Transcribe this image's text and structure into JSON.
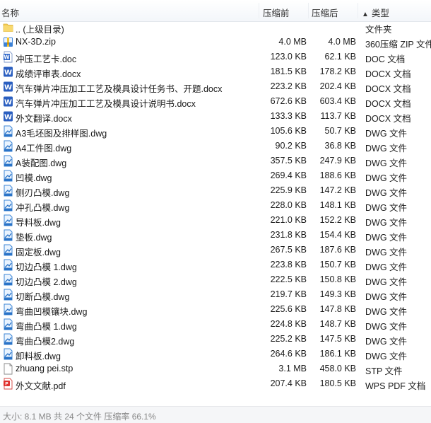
{
  "header": {
    "name_label": "名称",
    "orig_label": "压缩前",
    "comp_label": "压缩后",
    "type_label": "类型",
    "sort_arrow": "▲"
  },
  "rows": [
    {
      "name": ".. (上级目录)",
      "orig": "",
      "comp": "",
      "type": "文件夹",
      "icon": "folder-icon"
    },
    {
      "name": "NX-3D.zip",
      "orig": "4.0 MB",
      "comp": "4.0 MB",
      "type": "360压缩 ZIP 文件",
      "icon": "zip-icon"
    },
    {
      "name": "冲压工艺卡.doc",
      "orig": "123.0 KB",
      "comp": "62.1 KB",
      "type": "DOC 文档",
      "icon": "doc-icon"
    },
    {
      "name": "成绩评审表.docx",
      "orig": "181.5 KB",
      "comp": "178.2 KB",
      "type": "DOCX 文档",
      "icon": "docx-icon"
    },
    {
      "name": "汽车弹片冲压加工工艺及模具设计任务书、开题.docx",
      "orig": "223.2 KB",
      "comp": "202.4 KB",
      "type": "DOCX 文档",
      "icon": "docx-icon"
    },
    {
      "name": "汽车弹片冲压加工工艺及模具设计说明书.docx",
      "orig": "672.6 KB",
      "comp": "603.4 KB",
      "type": "DOCX 文档",
      "icon": "docx-icon"
    },
    {
      "name": "外文翻译.docx",
      "orig": "133.3 KB",
      "comp": "113.7 KB",
      "type": "DOCX 文档",
      "icon": "docx-icon"
    },
    {
      "name": "A3毛坯图及排样图.dwg",
      "orig": "105.6 KB",
      "comp": "50.7 KB",
      "type": "DWG 文件",
      "icon": "dwg-icon"
    },
    {
      "name": "A4工件图.dwg",
      "orig": "90.2 KB",
      "comp": "36.8 KB",
      "type": "DWG 文件",
      "icon": "dwg-icon"
    },
    {
      "name": "A装配图.dwg",
      "orig": "357.5 KB",
      "comp": "247.9 KB",
      "type": "DWG 文件",
      "icon": "dwg-icon"
    },
    {
      "name": "凹模.dwg",
      "orig": "269.4 KB",
      "comp": "188.6 KB",
      "type": "DWG 文件",
      "icon": "dwg-icon"
    },
    {
      "name": "侧刃凸模.dwg",
      "orig": "225.9 KB",
      "comp": "147.2 KB",
      "type": "DWG 文件",
      "icon": "dwg-icon"
    },
    {
      "name": "冲孔凸模.dwg",
      "orig": "228.0 KB",
      "comp": "148.1 KB",
      "type": "DWG 文件",
      "icon": "dwg-icon"
    },
    {
      "name": "导料板.dwg",
      "orig": "221.0 KB",
      "comp": "152.2 KB",
      "type": "DWG 文件",
      "icon": "dwg-icon"
    },
    {
      "name": "垫板.dwg",
      "orig": "231.8 KB",
      "comp": "154.4 KB",
      "type": "DWG 文件",
      "icon": "dwg-icon"
    },
    {
      "name": "固定板.dwg",
      "orig": "267.5 KB",
      "comp": "187.6 KB",
      "type": "DWG 文件",
      "icon": "dwg-icon"
    },
    {
      "name": "切边凸模 1.dwg",
      "orig": "223.8 KB",
      "comp": "150.7 KB",
      "type": "DWG 文件",
      "icon": "dwg-icon"
    },
    {
      "name": "切边凸模 2.dwg",
      "orig": "222.5 KB",
      "comp": "150.8 KB",
      "type": "DWG 文件",
      "icon": "dwg-icon"
    },
    {
      "name": "切断凸模.dwg",
      "orig": "219.7 KB",
      "comp": "149.3 KB",
      "type": "DWG 文件",
      "icon": "dwg-icon"
    },
    {
      "name": "弯曲凹模镶块.dwg",
      "orig": "225.6 KB",
      "comp": "147.8 KB",
      "type": "DWG 文件",
      "icon": "dwg-icon"
    },
    {
      "name": "弯曲凸模 1.dwg",
      "orig": "224.8 KB",
      "comp": "148.7 KB",
      "type": "DWG 文件",
      "icon": "dwg-icon"
    },
    {
      "name": "弯曲凸模2.dwg",
      "orig": "225.2 KB",
      "comp": "147.5 KB",
      "type": "DWG 文件",
      "icon": "dwg-icon"
    },
    {
      "name": "卸料板.dwg",
      "orig": "264.6 KB",
      "comp": "186.1 KB",
      "type": "DWG 文件",
      "icon": "dwg-icon"
    },
    {
      "name": "zhuang pei.stp",
      "orig": "3.1 MB",
      "comp": "458.0 KB",
      "type": "STP 文件",
      "icon": "stp-file-icon"
    },
    {
      "name": "外文文献.pdf",
      "orig": "207.4 KB",
      "comp": "180.5 KB",
      "type": "WPS PDF 文档",
      "icon": "pdf-icon"
    }
  ],
  "status": {
    "text": "大小: 8.1 MB 共 24 个文件 压缩率 66.1%"
  }
}
